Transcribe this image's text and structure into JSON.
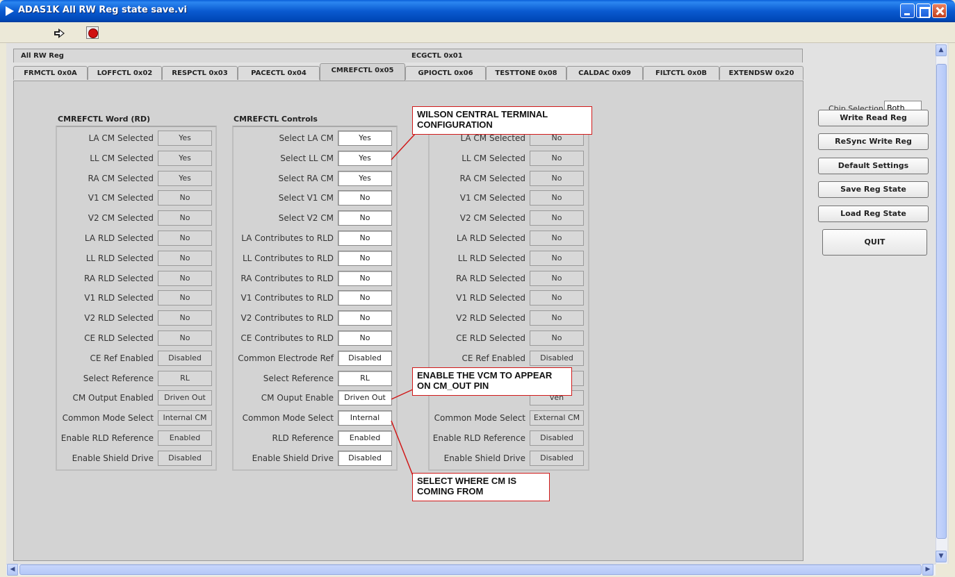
{
  "window": {
    "title": "ADAS1K All RW Reg state save.vi"
  },
  "tabs": {
    "top_row": [
      "All RW Reg",
      "ECGCTL 0x01"
    ],
    "bottom_row": [
      "FRMCTL 0x0A",
      "LOFFCTL 0x02",
      "RESPCTL 0x03",
      "PACECTL 0x04",
      "CMREFCTL 0x05",
      "GPIOCTL 0x06",
      "TESTTONE 0x08",
      "CALDAC 0x09",
      "FILTCTL 0x0B",
      "EXTENDSW 0x20"
    ],
    "active": "CMREFCTL 0x05"
  },
  "left_column": {
    "title": "CMREFCTL Word (RD)",
    "rows": [
      {
        "label": "LA CM Selected",
        "value": "Yes"
      },
      {
        "label": "LL CM Selected",
        "value": "Yes"
      },
      {
        "label": "RA CM Selected",
        "value": "Yes"
      },
      {
        "label": "V1 CM Selected",
        "value": "No"
      },
      {
        "label": "V2 CM Selected",
        "value": "No"
      },
      {
        "label": "LA RLD Selected",
        "value": "No"
      },
      {
        "label": "LL RLD Selected",
        "value": "No"
      },
      {
        "label": "RA RLD Selected",
        "value": "No"
      },
      {
        "label": "V1 RLD Selected",
        "value": "No"
      },
      {
        "label": "V2 RLD Selected",
        "value": "No"
      },
      {
        "label": "CE RLD Selected",
        "value": "No"
      },
      {
        "label": "CE Ref Enabled",
        "value": "Disabled"
      },
      {
        "label": "Select Reference",
        "value": "RL"
      },
      {
        "label": "CM Output Enabled",
        "value": "Driven Out"
      },
      {
        "label": "Common Mode Select",
        "value": "Internal CM"
      },
      {
        "label": "Enable RLD Reference",
        "value": "Enabled"
      },
      {
        "label": "Enable Shield Drive",
        "value": "Disabled"
      }
    ]
  },
  "middle_column": {
    "title": "CMREFCTL Controls",
    "rows": [
      {
        "label": "Select LA CM",
        "value": "Yes"
      },
      {
        "label": "Select LL CM",
        "value": "Yes"
      },
      {
        "label": "Select RA CM",
        "value": "Yes"
      },
      {
        "label": "Select V1 CM",
        "value": "No"
      },
      {
        "label": "Select V2 CM",
        "value": "No"
      },
      {
        "label": "LA Contributes to RLD",
        "value": "No"
      },
      {
        "label": "LL Contributes to RLD",
        "value": "No"
      },
      {
        "label": "RA Contributes to RLD",
        "value": "No"
      },
      {
        "label": "V1 Contributes to RLD",
        "value": "No"
      },
      {
        "label": "V2 Contributes to RLD",
        "value": "No"
      },
      {
        "label": "CE Contributes to RLD",
        "value": "No"
      },
      {
        "label": "Common Electrode Ref",
        "value": "Disabled"
      },
      {
        "label": "Select Reference",
        "value": "RL"
      },
      {
        "label": "CM Ouput Enable",
        "value": "Driven Out"
      },
      {
        "label": "Common Mode Select",
        "value": "Internal"
      },
      {
        "label": "RLD Reference",
        "value": "Enabled"
      },
      {
        "label": "Enable Shield Drive",
        "value": "Disabled"
      }
    ]
  },
  "right_column": {
    "rows": [
      {
        "label": "LA CM Selected",
        "value": "No"
      },
      {
        "label": "LL CM Selected",
        "value": "No"
      },
      {
        "label": "RA CM Selected",
        "value": "No"
      },
      {
        "label": "V1 CM Selected",
        "value": "No"
      },
      {
        "label": "V2 CM Selected",
        "value": "No"
      },
      {
        "label": "LA RLD Selected",
        "value": "No"
      },
      {
        "label": "LL RLD Selected",
        "value": "No"
      },
      {
        "label": "RA RLD Selected",
        "value": "No"
      },
      {
        "label": "V1 RLD Selected",
        "value": "No"
      },
      {
        "label": "V2 RLD Selected",
        "value": "No"
      },
      {
        "label": "CE RLD Selected",
        "value": "No"
      },
      {
        "label": "CE Ref Enabled",
        "value": "Disabled"
      },
      {
        "label": "",
        "value": ""
      },
      {
        "label": "",
        "value": "ven"
      },
      {
        "label": "Common Mode Select",
        "value": "External CM"
      },
      {
        "label": "Enable RLD Reference",
        "value": "Disabled"
      },
      {
        "label": "Enable Shield Drive",
        "value": "Disabled"
      }
    ]
  },
  "side_panel": {
    "chip_selection_label": "Chip Selection",
    "chip_selection_value": "Both",
    "buttons": [
      "Write Read Reg",
      "ReSync Write Reg",
      "Default Settings",
      "Save Reg State",
      "Load Reg State"
    ],
    "quit_label": "QUIT"
  },
  "callouts": {
    "wilson": "WILSON CENTRAL TERMINAL CONFIGURATION",
    "vcm": "ENABLE THE VCM TO APPEAR ON CM_OUT PIN",
    "cm_source": "SELECT WHERE CM IS COMING FROM"
  },
  "colors": {
    "callout_border": "#d01818",
    "title_bar": "#0a5ad0"
  }
}
